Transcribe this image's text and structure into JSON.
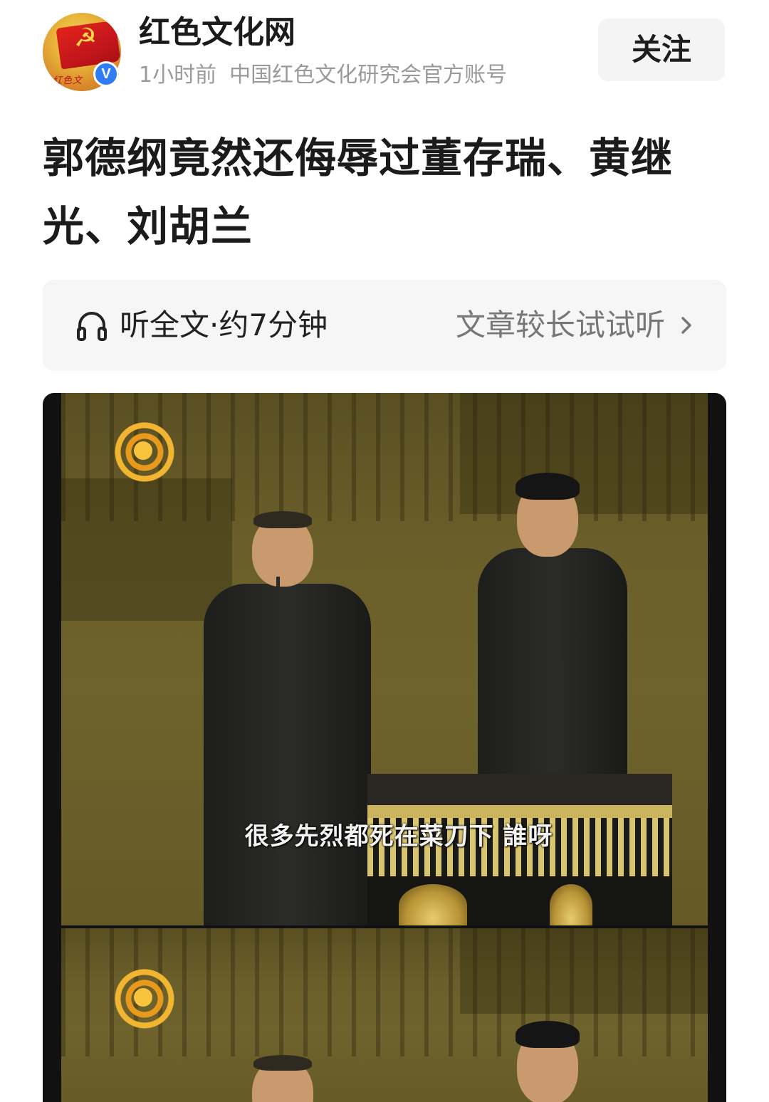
{
  "header": {
    "account_name": "红色文化网",
    "time": "1小时前",
    "description": "中国红色文化研究会官方账号",
    "follow_label": "关注",
    "verified_badge": "V",
    "avatar_icon": "hammer-and-sickle-flag-icon"
  },
  "article": {
    "title": "郭德纲竟然还侮辱过董存瑞、黄继光、刘胡兰"
  },
  "listen_bar": {
    "label": "听全文·约7分钟",
    "hint": "文章较长试试听",
    "icons": [
      "headphone-icon",
      "chevron-right-icon"
    ]
  },
  "image": {
    "subtitle": "很多先烈都死在菜刀下 誰呀",
    "logo_icon": "phoenix-logo-icon"
  },
  "colors": {
    "verified_blue": "#2f7df6",
    "button_bg": "#f4f4f4",
    "listen_bg": "#f6f6f6",
    "meta_gray": "#9a9a9a"
  }
}
